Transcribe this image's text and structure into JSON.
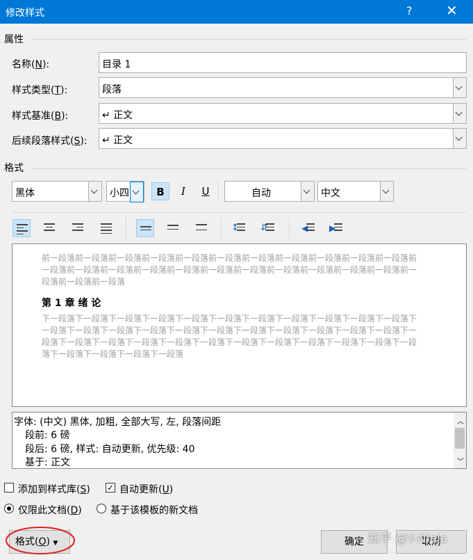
{
  "window": {
    "title": "修改样式",
    "help_glyph": "?",
    "close_glyph": "✕"
  },
  "properties": {
    "group_label": "属性",
    "name_label": "名称(",
    "name_key": "N",
    "name_value": "目录 1",
    "type_label": "样式类型(",
    "type_key": "T",
    "type_value": "段落",
    "base_label": "样式基准(",
    "base_key": "B",
    "base_value": "↵ 正文",
    "next_label": "后续段落样式(",
    "next_key": "S",
    "next_value": "↵ 正文",
    "label_suffix": "):"
  },
  "format": {
    "group_label": "格式",
    "font_value": "黑体",
    "size_value": "小四",
    "bold": "B",
    "italic": "I",
    "underline": "U",
    "color_value": "自动",
    "script_value": "中文"
  },
  "preview": {
    "before_text": "前一段落前一段落前一段落前一段落前一段落前一段落前一段落前一段落前一段落前一段落前一段落前一段落前一段落前一段落前一段落前一段落前一段落前一段落前一段落前一段落前一段落前一段落前一段落前一段落前一段落",
    "heading": "第 1 章  绪  论",
    "after_text": "下一段落下一段落下一段落下一段落下一段落下一段落下一段落下一段落下一段落下一段落下一段落下一段落下一段落下一段落下一段落下一段落下一段落下一段落下一段落下一段落下一段落下一段落下一段落下一段落下一段落下一段落下一段落下一段落下一段落下一段落下一段落下一段落下一段落下一段落下一段落下一段落下一段落下一段落"
  },
  "description": {
    "line1": "字体: (中文) 黑体, 加粗, 全部大写, 左, 段落间距",
    "line2": "段前: 6 磅",
    "line3": "段后: 6 磅, 样式: 自动更新, 优先级: 40",
    "line4": "基于: 正文"
  },
  "options": {
    "add_gallery": "添加到样式库(",
    "add_gallery_key": "S",
    "auto_update": "自动更新(",
    "auto_update_key": "U",
    "auto_update_checked": true,
    "add_gallery_checked": false,
    "only_doc": "仅限此文档(",
    "only_doc_key": "D",
    "template_docs": "基于该模板的新文档",
    "close_paren": ")"
  },
  "buttons": {
    "format": "格式(",
    "format_key": "O",
    "ok": "确定",
    "cancel": "取消"
  },
  "watermark": "知乎 @Y-Ninja"
}
